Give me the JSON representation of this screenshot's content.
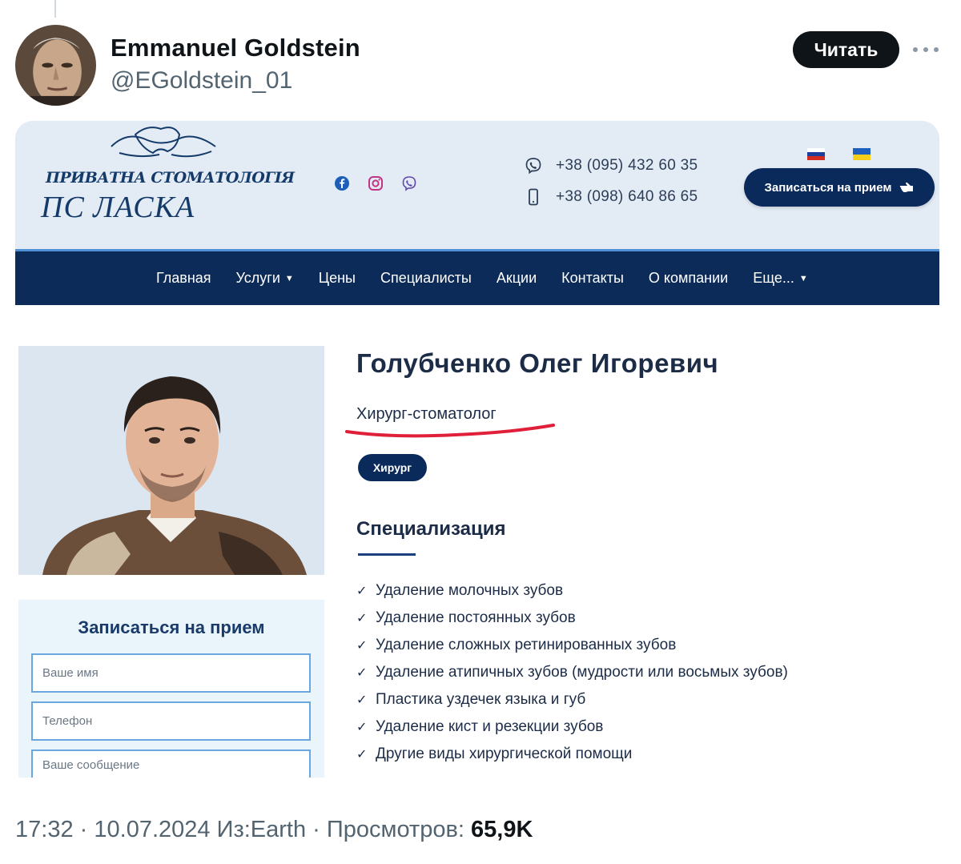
{
  "tweet": {
    "author_name": "Emmanuel Goldstein",
    "author_handle": "@EGoldstein_01",
    "follow_label": "Читать",
    "time": "17:32",
    "date": "10.07.2024",
    "location": "Из:Earth",
    "views_label": "Просмотров:",
    "views_count": "65,9K",
    "sep": "·"
  },
  "site": {
    "logo": {
      "line1": "ПРИВАТНА СТОМАТОЛОГІЯ",
      "line2": "ПС  ЛАСКА"
    },
    "phones": [
      "+38 (095) 432 60 35",
      "+38 (098) 640 86 65"
    ],
    "book_button": "Записаться на прием",
    "nav": [
      {
        "label": "Главная",
        "dropdown": false
      },
      {
        "label": "Услуги",
        "dropdown": true
      },
      {
        "label": "Цены",
        "dropdown": false
      },
      {
        "label": "Специалисты",
        "dropdown": false
      },
      {
        "label": "Акции",
        "dropdown": false
      },
      {
        "label": "Контакты",
        "dropdown": false
      },
      {
        "label": "О компании",
        "dropdown": false
      },
      {
        "label": "Еще...",
        "dropdown": true
      }
    ],
    "doctor": {
      "name": "Голубченко Олег Игоревич",
      "role": "Хирург-стоматолог",
      "tag": "Хирург",
      "spec_title": "Специализация",
      "specializations": [
        "Удаление молочных зубов",
        "Удаление постоянных зубов",
        "Удаление сложных ретинированных зубов",
        "Удаление атипичных зубов (мудрости или восьмых зубов)",
        "Пластика уздечек языка и губ",
        "Удаление кист и резекции зубов",
        "Другие виды хирургической помощи"
      ]
    },
    "form": {
      "title": "Записаться на прием",
      "name_placeholder": "Ваше имя",
      "phone_placeholder": "Телефон",
      "message_placeholder": "Ваше сообщение"
    },
    "colors": {
      "header_bg": "#e3ebf5",
      "nav_bg": "#0d2b58",
      "accent": "#0b2a5c",
      "underline_mark": "#e0203a"
    }
  }
}
